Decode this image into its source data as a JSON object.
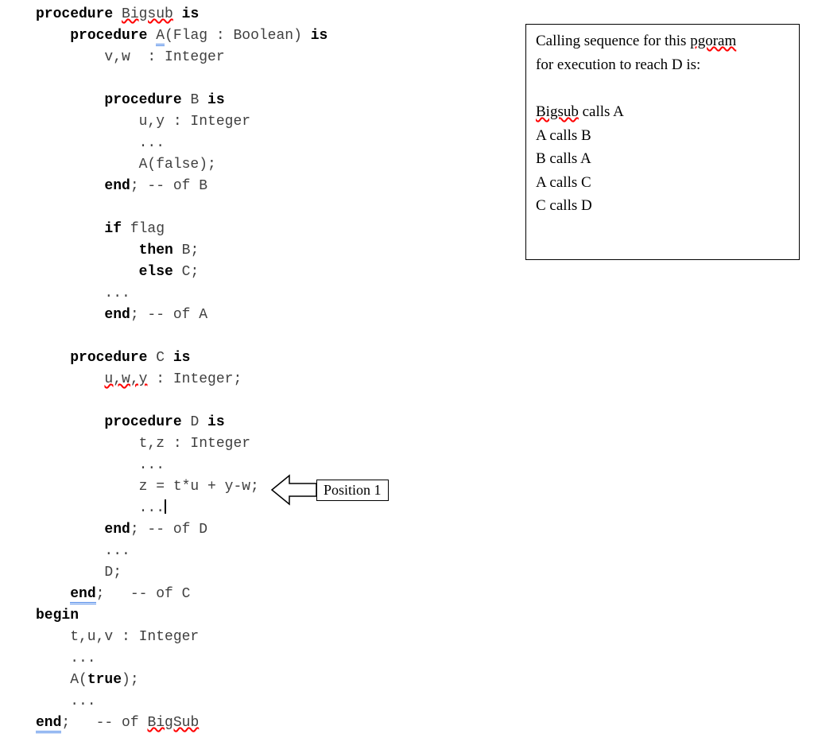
{
  "code": {
    "l1_kw1": "procedure",
    "l1_name": "Bigsub",
    "l1_kw2": "is",
    "l2_kw1": "procedure",
    "l2_name": "A",
    "l2_rest": "(Flag : Boolean)",
    "l2_kw2": "is",
    "l3": "        v,w  : Integer",
    "l4_kw1": "procedure",
    "l4_rest": " B ",
    "l4_kw2": "is",
    "l5": "            u,y : Integer",
    "l6": "            ...",
    "l7": "            A(false);",
    "l8_kw": "end",
    "l8_rest": "; -- of B",
    "l9_kw": "if",
    "l9_rest": " flag",
    "l10_kw": "then",
    "l10_rest": " B;",
    "l11_kw": "else",
    "l11_rest": " C;",
    "l12": "        ...",
    "l13_kw": "end",
    "l13_rest": "; -- of A",
    "l14_kw1": "procedure",
    "l14_rest": " C ",
    "l14_kw2": "is",
    "l15_vars": "u,w,y",
    "l15_rest": " : Integer;",
    "l16_kw1": "procedure",
    "l16_rest": " D ",
    "l16_kw2": "is",
    "l17": "            t,z : Integer",
    "l18": "            ...",
    "l19": "            z = t*u + y-w;",
    "l20": "            ...",
    "l21_kw": "end",
    "l21_rest": "; -- of D",
    "l22": "        ...",
    "l23": "        D;",
    "l24_kw": "end",
    "l24_rest": ";   -- of C",
    "l25_kw": "begin",
    "l26": "    t,u,v : Integer",
    "l27": "    ...",
    "l28_a": "    A(",
    "l28_kw": "true",
    "l28_b": ");",
    "l29": "    ...",
    "l30_kw": "end",
    "l30_rest": ";   -- of ",
    "l30_name": "BigSub"
  },
  "sidebar": {
    "p1a": "Calling sequence for this ",
    "p1b": "pgoram",
    "p2": "for execution to reach D is:",
    "c1a": "Bigsub",
    "c1b": " calls A",
    "c2": "A calls B",
    "c3": "B calls A",
    "c4": "A calls C",
    "c5": "C calls D"
  },
  "arrow": {
    "label": "Position 1"
  }
}
